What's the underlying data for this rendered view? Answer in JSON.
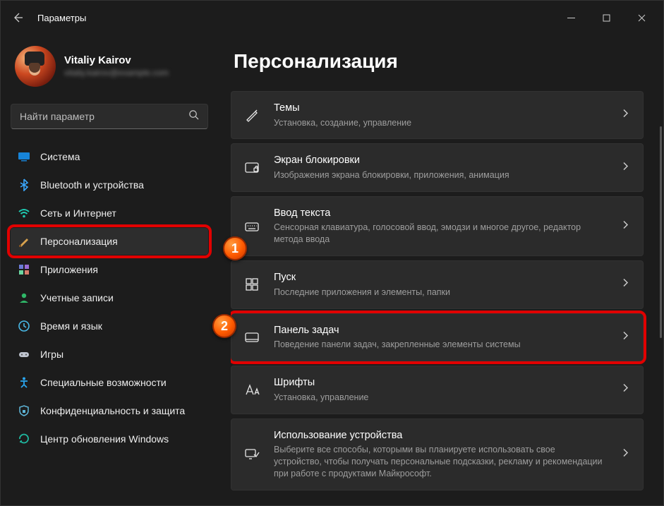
{
  "app_title": "Параметры",
  "profile": {
    "name": "Vitaliy Kairov",
    "email": "vitaliy.kairov@example.com"
  },
  "search": {
    "placeholder": "Найти параметр"
  },
  "sidebar": {
    "items": [
      {
        "label": "Система",
        "icon": "system"
      },
      {
        "label": "Bluetooth и устройства",
        "icon": "bluetooth"
      },
      {
        "label": "Сеть и Интернет",
        "icon": "network"
      },
      {
        "label": "Персонализация",
        "icon": "personalization",
        "active": true,
        "highlight": true
      },
      {
        "label": "Приложения",
        "icon": "apps"
      },
      {
        "label": "Учетные записи",
        "icon": "accounts"
      },
      {
        "label": "Время и язык",
        "icon": "time"
      },
      {
        "label": "Игры",
        "icon": "gaming"
      },
      {
        "label": "Специальные возможности",
        "icon": "accessibility"
      },
      {
        "label": "Конфиденциальность и защита",
        "icon": "privacy"
      },
      {
        "label": "Центр обновления Windows",
        "icon": "update"
      }
    ]
  },
  "page": {
    "title": "Персонализация"
  },
  "cards": [
    {
      "title": "Темы",
      "sub": "Установка, создание, управление",
      "icon": "themes"
    },
    {
      "title": "Экран блокировки",
      "sub": "Изображения экрана блокировки, приложения, анимация",
      "icon": "lockscreen"
    },
    {
      "title": "Ввод текста",
      "sub": "Сенсорная клавиатура, голосовой ввод, эмодзи и многое другое, редактор метода ввода",
      "icon": "input"
    },
    {
      "title": "Пуск",
      "sub": "Последние приложения и элементы, папки",
      "icon": "start"
    },
    {
      "title": "Панель задач",
      "sub": "Поведение панели задач, закрепленные элементы системы",
      "icon": "taskbar",
      "highlight": true
    },
    {
      "title": "Шрифты",
      "sub": "Установка, управление",
      "icon": "fonts"
    },
    {
      "title": "Использование устройства",
      "sub": "Выберите все способы, которыми вы планируете использовать свое устройство, чтобы получать персональные подсказки, рекламу и рекомендации при работе с продуктами Майкрософт.",
      "icon": "usage"
    }
  ],
  "callouts": {
    "c1": "1",
    "c2": "2"
  }
}
